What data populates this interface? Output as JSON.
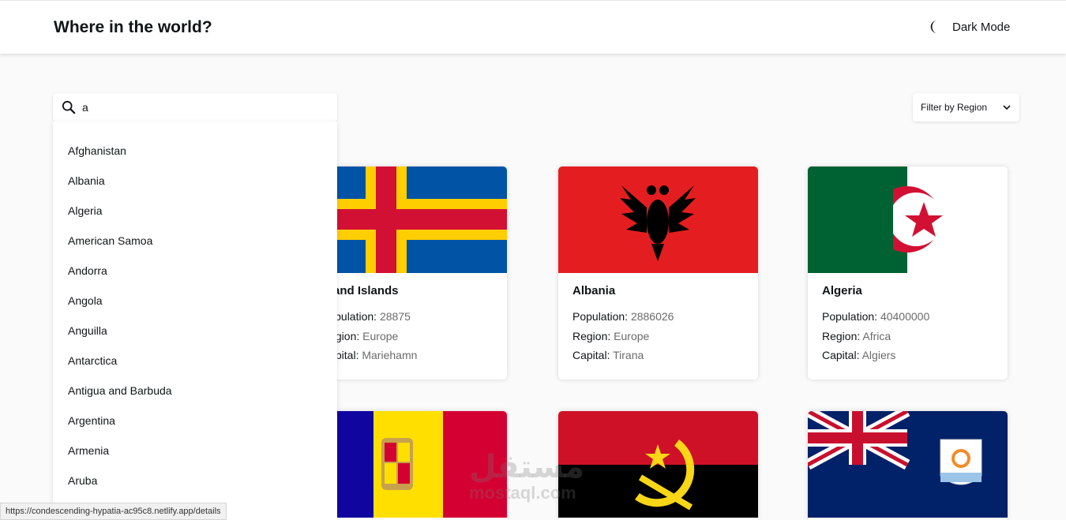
{
  "header": {
    "title": "Where in the world?",
    "mode_label": "Dark Mode"
  },
  "search": {
    "value": "a"
  },
  "filter": {
    "label": "Filter by Region"
  },
  "dropdown": {
    "items": [
      "Afghanistan",
      "Albania",
      "Algeria",
      "American Samoa",
      "Andorra",
      "Angola",
      "Anguilla",
      "Antarctica",
      "Antigua and Barbuda",
      "Argentina",
      "Armenia",
      "Aruba"
    ]
  },
  "labels": {
    "population": "Population:",
    "region": "Region:",
    "capital": "Capital:"
  },
  "cards": [
    {
      "name": "Åland Islands",
      "population": "28875",
      "region": "Europe",
      "capital": "Mariehamn"
    },
    {
      "name": "Albania",
      "population": "2886026",
      "region": "Europe",
      "capital": "Tirana"
    },
    {
      "name": "Algeria",
      "population": "40400000",
      "region": "Africa",
      "capital": "Algiers"
    }
  ],
  "second_row_flags": [
    "Andorra",
    "Angola",
    "Anguilla"
  ],
  "status_bar": {
    "url": "https://condescending-hypatia-ac95c8.netlify.app/details"
  },
  "watermark": {
    "arabic": "مستقل",
    "latin": "mostaql.com"
  },
  "colors": {
    "background": "#fafafa",
    "text": "#111517",
    "secondary_text": "#6b6b6b"
  }
}
